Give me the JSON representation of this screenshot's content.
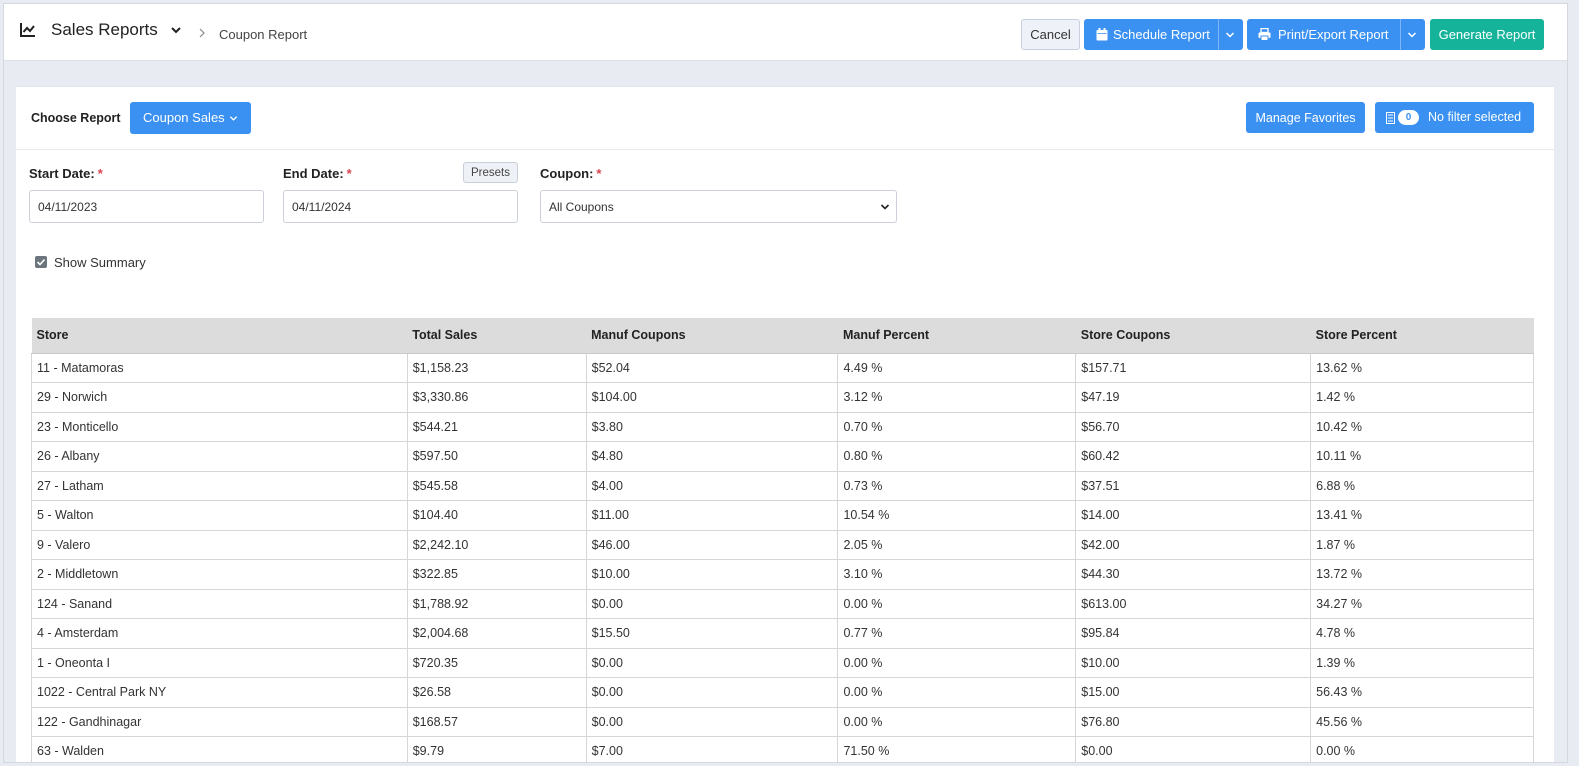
{
  "header": {
    "title": "Sales Reports",
    "breadcrumb": "Coupon Report",
    "cancel_label": "Cancel",
    "schedule_label": "Schedule Report",
    "print_label": "Print/Export Report",
    "generate_label": "Generate Report"
  },
  "panel": {
    "choose_label": "Choose Report",
    "report_type": "Coupon Sales",
    "favorites_label": "Manage Favorites",
    "filter_count": "0",
    "filter_label": "No filter selected"
  },
  "form": {
    "start_label": "Start Date:",
    "start_value": "04/11/2023",
    "end_label": "End Date:",
    "end_value": "04/11/2024",
    "presets_label": "Presets",
    "coupon_label": "Coupon:",
    "coupon_value": "All Coupons",
    "required_mark": "*",
    "show_summary_label": "Show Summary",
    "show_summary_checked": true
  },
  "table": {
    "columns": [
      "Store",
      "Total Sales",
      "Manuf Coupons",
      "Manuf Percent",
      "Store Coupons",
      "Store Percent"
    ],
    "rows": [
      [
        "11 - Matamoras",
        "$1,158.23",
        "$52.04",
        "4.49 %",
        "$157.71",
        "13.62 %"
      ],
      [
        "29 - Norwich",
        "$3,330.86",
        "$104.00",
        "3.12 %",
        "$47.19",
        "1.42 %"
      ],
      [
        "23 - Monticello",
        "$544.21",
        "$3.80",
        "0.70 %",
        "$56.70",
        "10.42 %"
      ],
      [
        "26 - Albany",
        "$597.50",
        "$4.80",
        "0.80 %",
        "$60.42",
        "10.11 %"
      ],
      [
        "27 - Latham",
        "$545.58",
        "$4.00",
        "0.73 %",
        "$37.51",
        "6.88 %"
      ],
      [
        "5 - Walton",
        "$104.40",
        "$11.00",
        "10.54 %",
        "$14.00",
        "13.41 %"
      ],
      [
        "9 - Valero",
        "$2,242.10",
        "$46.00",
        "2.05 %",
        "$42.00",
        "1.87 %"
      ],
      [
        "2 - Middletown",
        "$322.85",
        "$10.00",
        "3.10 %",
        "$44.30",
        "13.72 %"
      ],
      [
        "124 - Sanand",
        "$1,788.92",
        "$0.00",
        "0.00 %",
        "$613.00",
        "34.27 %"
      ],
      [
        "4 - Amsterdam",
        "$2,004.68",
        "$15.50",
        "0.77 %",
        "$95.84",
        "4.78 %"
      ],
      [
        "1 - Oneonta I",
        "$720.35",
        "$0.00",
        "0.00 %",
        "$10.00",
        "1.39 %"
      ],
      [
        "1022 - Central Park NY",
        "$26.58",
        "$0.00",
        "0.00 %",
        "$15.00",
        "56.43 %"
      ],
      [
        "122 - Gandhinagar",
        "$168.57",
        "$0.00",
        "0.00 %",
        "$76.80",
        "45.56 %"
      ],
      [
        "63 - Walden",
        "$9.79",
        "$7.00",
        "71.50 %",
        "$0.00",
        "0.00 %"
      ]
    ]
  },
  "colors": {
    "primary": "#3b91f2",
    "success": "#15b39a",
    "required": "#d9434e",
    "table_header": "#dcdcdc"
  }
}
